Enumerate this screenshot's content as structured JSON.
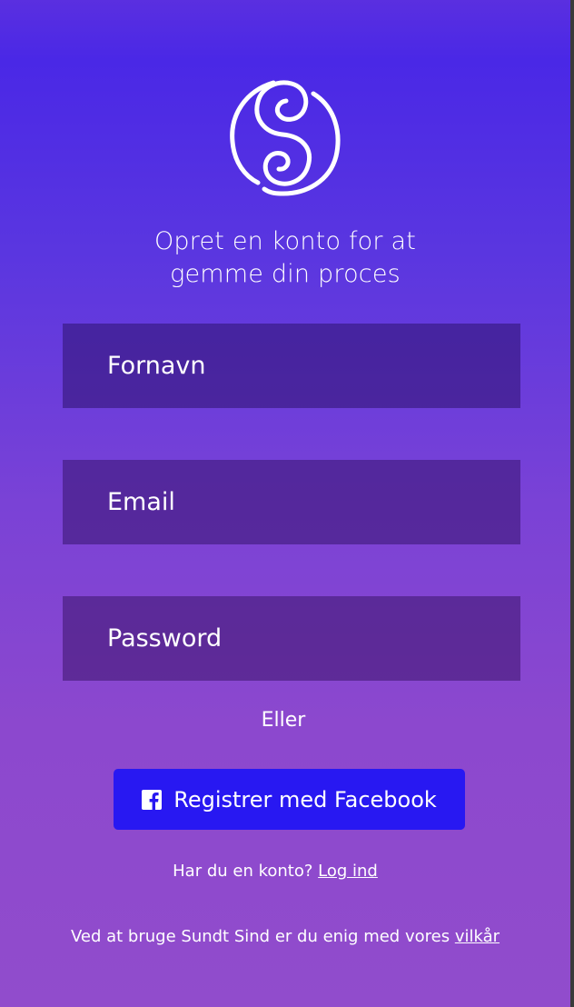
{
  "app": {
    "brand_mark": "Sundt Sind logo"
  },
  "signup": {
    "headline_line1": "Opret en konto for at",
    "headline_line2": "gemme din proces",
    "fields": {
      "first_name_placeholder": "Fornavn",
      "email_placeholder": "Email",
      "password_placeholder": "Password"
    },
    "or_label": "Eller",
    "facebook_button_label": "Registrer med Facebook",
    "login_prompt": "Har du en konto?",
    "login_link": "Log ind",
    "terms_text": "Ved at bruge Sundt Sind er du enig med vores",
    "terms_link": "vilkår"
  },
  "colors": {
    "gradient_top": "#4a28e6",
    "gradient_bottom": "#914ccc",
    "facebook_button": "#2818f2",
    "text": "#ffffff"
  },
  "icons": {
    "logo": "sundt-sind-logo-icon",
    "facebook": "facebook-icon"
  }
}
